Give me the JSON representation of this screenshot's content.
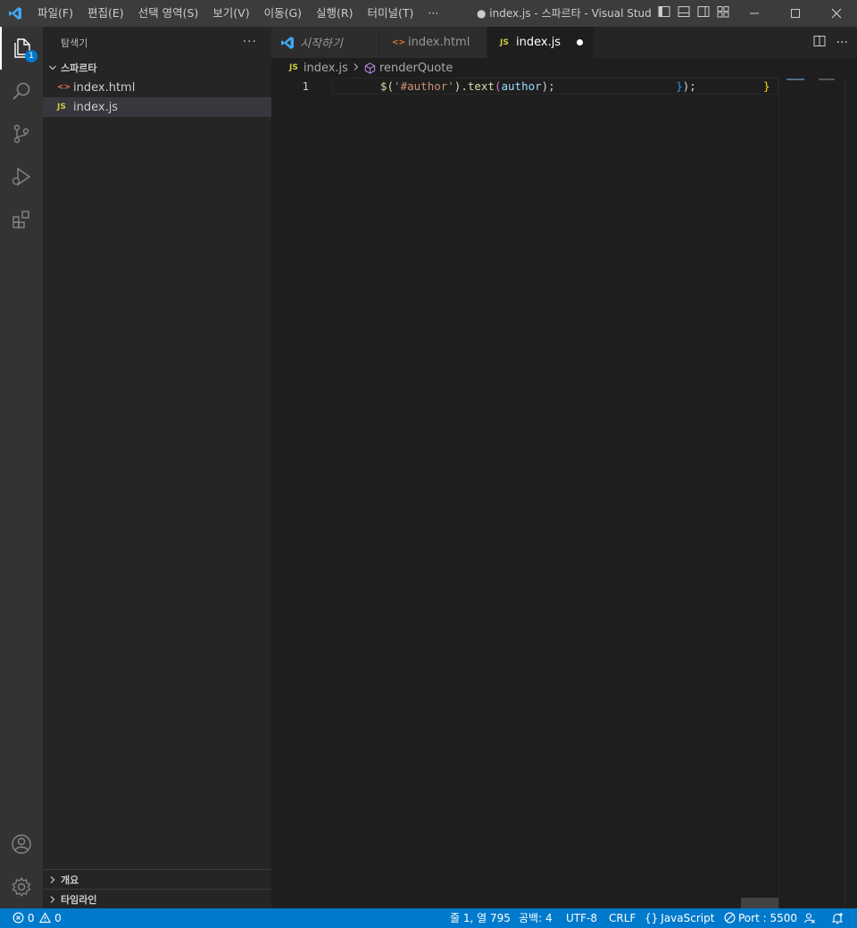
{
  "menu": [
    "파일(F)",
    "편집(E)",
    "선택 영역(S)",
    "보기(V)",
    "이동(G)",
    "실행(R)",
    "터미널(T)",
    "···"
  ],
  "window_title": "● index.js - 스파르타 - Visual Studio...",
  "activity": {
    "explorer_badge": "1"
  },
  "sidebar": {
    "title": "탐색기",
    "more": "···",
    "folder": "스파르타",
    "files": [
      {
        "label": "index.html",
        "icon": "<>",
        "icon_color": "#e37933"
      },
      {
        "label": "index.js",
        "icon": "JS",
        "icon_color": "#cbcb41"
      }
    ],
    "sections": [
      "개요",
      "타임라인"
    ]
  },
  "tabs": [
    {
      "label": "시작하기"
    },
    {
      "label": "index.html",
      "icon": "<>"
    },
    {
      "label": "index.js",
      "icon": "JS"
    }
  ],
  "tab_actions": {
    "more": "···"
  },
  "breadcrumb": {
    "file": "index.js",
    "file_icon": "JS",
    "symbol": "renderQuote"
  },
  "editor": {
    "line_number": "1",
    "tokens": [
      {
        "text": "$(",
        "color": "#dcdcaa"
      },
      {
        "text": "'#author'",
        "color": "#ce9178"
      },
      {
        "text": ")",
        "color": "#dcdcaa"
      },
      {
        "text": ".",
        "color": "#d4d4d4"
      },
      {
        "text": "text",
        "color": "#dcdcaa"
      },
      {
        "text": "(",
        "color": "#da70d6"
      },
      {
        "text": "author",
        "color": "#9cdcfe"
      },
      {
        "text": ");",
        "color": "#d4d4d4"
      },
      {
        "text": "                  ",
        "color": "#d4d4d4"
      },
      {
        "text": "}",
        "color": "#179fff"
      },
      {
        "text": ");",
        "color": "#d4d4d4"
      },
      {
        "text": "          ",
        "color": "#d4d4d4"
      },
      {
        "text": "}",
        "color": "#ffd700"
      }
    ]
  },
  "statusbar": {
    "errors": "0",
    "warnings": "0",
    "position": "줄 1, 열 795",
    "spaces": "공백: 4",
    "encoding": "UTF-8",
    "eol": "CRLF",
    "language": "JavaScript",
    "port": "Port : 5500"
  },
  "colors": {
    "accent": "#007acc",
    "js_icon": "#cbcb41",
    "html_icon": "#e37933"
  }
}
